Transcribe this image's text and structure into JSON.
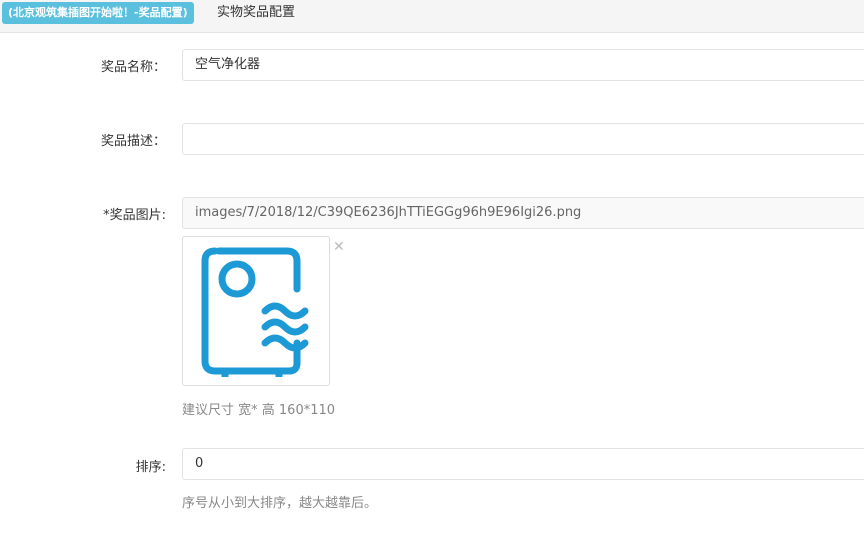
{
  "topbar": {
    "badge_text": "(北京观筑集插图开始啦！-奖品配置)",
    "title": "实物奖品配置"
  },
  "form": {
    "name_label": "奖品名称：",
    "name_value": "空气净化器",
    "desc_label": "奖品描述：",
    "desc_value": "",
    "image_label": "*奖品图片:",
    "image_path": "images/7/2018/12/C39QE6236JhTTiEGGg96h9E96Igi26.png",
    "image_icon": "air-purifier-icon",
    "remove_icon": "close-x-icon",
    "image_hint": "建议尺寸 宽* 高 160*110",
    "sort_label": "排序:",
    "sort_value": "0",
    "sort_hint": "序号从小到大排序，越大越靠后。"
  },
  "colors": {
    "badge_bg": "#5bc0de",
    "icon_blue": "#1d9ad6"
  }
}
